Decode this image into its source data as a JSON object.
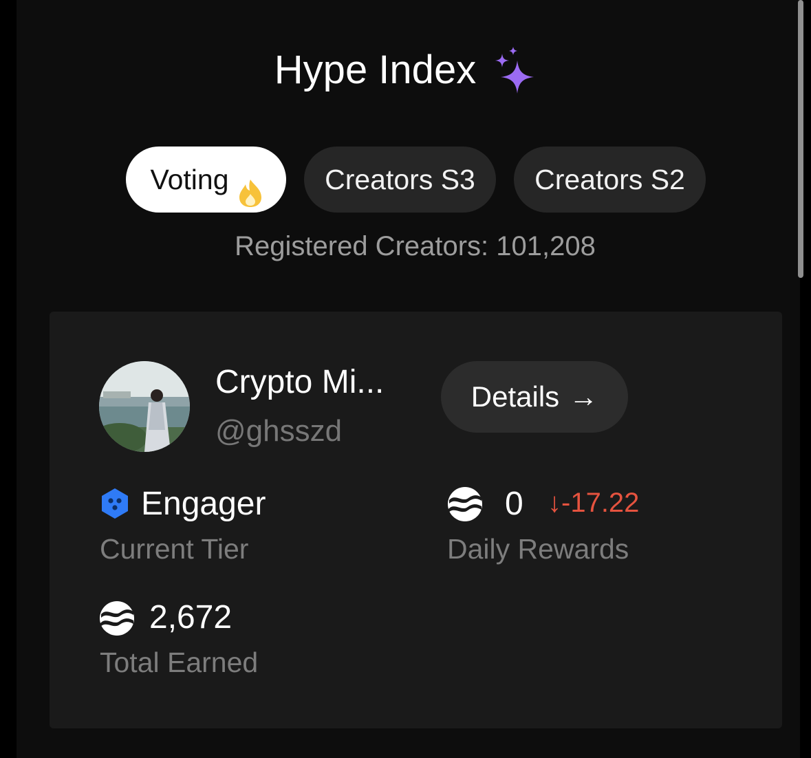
{
  "header": {
    "title": "Hype Index"
  },
  "tabs": [
    {
      "label": "Voting",
      "active": true
    },
    {
      "label": "Creators S3",
      "active": false
    },
    {
      "label": "Creators S2",
      "active": false
    }
  ],
  "registered_creators": "Registered Creators: 101,208",
  "profile": {
    "name": "Crypto Mi...",
    "handle": "@ghsszd",
    "details_label": "Details",
    "details_arrow": "→"
  },
  "stats": {
    "tier": {
      "value": "Engager",
      "label": "Current Tier"
    },
    "daily_rewards": {
      "value": "0",
      "delta_arrow": "↓",
      "delta": "-17.22",
      "label": "Daily Rewards"
    },
    "total_earned": {
      "value": "2,672",
      "label": "Total Earned"
    }
  },
  "colors": {
    "accent_sparkle": "#9b6bf2",
    "tier_icon": "#2f7bf6",
    "negative": "#e5533f",
    "flame": "#f7c23a"
  }
}
